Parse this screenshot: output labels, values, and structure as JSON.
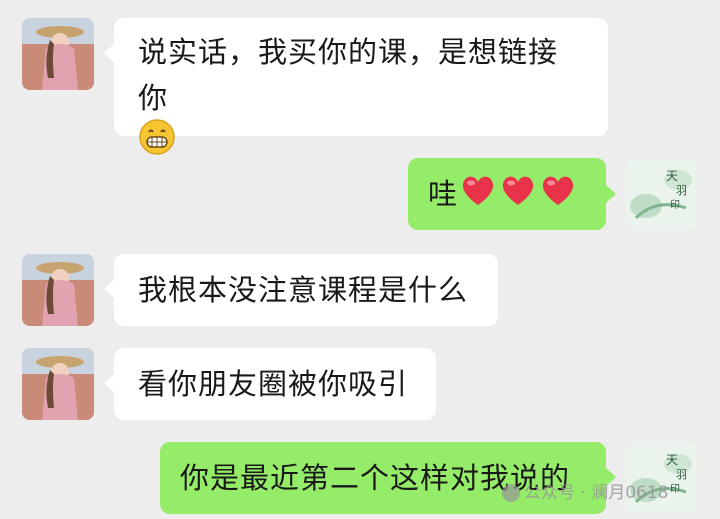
{
  "messages": [
    {
      "side": "left",
      "text": "说实话，我买你的课，是想链接你",
      "emoji": "grinning-face"
    },
    {
      "side": "right",
      "text": "哇",
      "emoji": "red-hearts"
    },
    {
      "side": "left",
      "text": "我根本没注意课程是什么"
    },
    {
      "side": "left",
      "text": "看你朋友圈被你吸引"
    },
    {
      "side": "right",
      "text": "你是最近第二个这样对我说的"
    }
  ],
  "watermark": {
    "text": "公众号 · 澜月0618"
  }
}
